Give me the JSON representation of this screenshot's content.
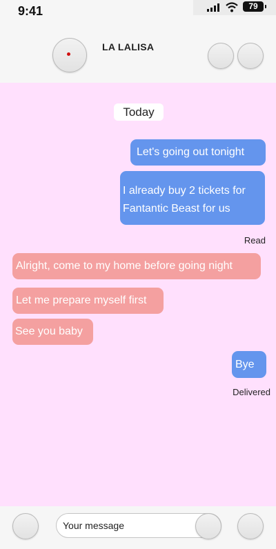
{
  "status_bar": {
    "time": "9:41",
    "battery": "79",
    "icons": [
      "signal-icon",
      "wifi-icon",
      "battery-icon"
    ]
  },
  "header": {
    "contact_name": "LA LALISA"
  },
  "chat": {
    "date_label": "Today",
    "messages": [
      {
        "direction": "outgoing",
        "text": "Let's going out tonight"
      },
      {
        "direction": "outgoing",
        "text": "I already buy 2 tickets for Fantantic Beast for us"
      },
      {
        "direction": "incoming",
        "text": "Alright, come to my home before going night"
      },
      {
        "direction": "incoming",
        "text": "Let me prepare myself first"
      },
      {
        "direction": "incoming",
        "text": "See you baby"
      },
      {
        "direction": "outgoing",
        "text": "Bye"
      }
    ],
    "receipts": {
      "read": "Read",
      "delivered": "Delivered"
    }
  },
  "composer": {
    "placeholder": "Your message",
    "value": ""
  },
  "colors": {
    "chat_background": "#ffe0fd",
    "outgoing_bubble": "#6495ed",
    "incoming_bubble": "#f4a0a0",
    "bar_background": "#f6f6f6"
  }
}
